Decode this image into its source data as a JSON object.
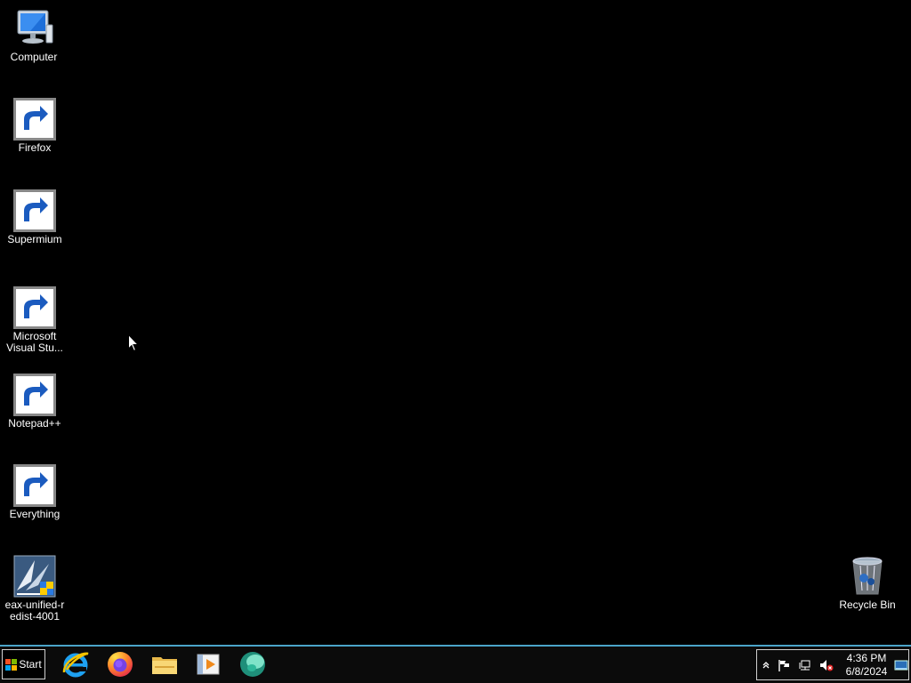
{
  "desktop": {
    "icons": [
      {
        "label": "Computer",
        "icon": "computer-icon",
        "shortcut": false
      },
      {
        "label": "Firefox",
        "icon": "firefox-icon",
        "shortcut": true
      },
      {
        "label": "Supermium",
        "icon": "supermium-icon",
        "shortcut": true
      },
      {
        "label": "Microsoft Visual Stu...",
        "icon": "visual-studio-icon",
        "shortcut": true
      },
      {
        "label": "Notepad++",
        "icon": "notepad-plus-plus-icon",
        "shortcut": true
      },
      {
        "label": "Everything",
        "icon": "everything-search-icon",
        "shortcut": true
      },
      {
        "label": "eax-unified-r edist-4001",
        "icon": "installer-icon",
        "shortcut": false
      },
      {
        "label": "Recycle Bin",
        "icon": "recycle-bin-icon",
        "shortcut": false
      }
    ]
  },
  "taskbar": {
    "start_label": "Start",
    "pinned": [
      {
        "name": "Internet Explorer",
        "icon": "internet-explorer-icon"
      },
      {
        "name": "Firefox",
        "icon": "firefox-icon"
      },
      {
        "name": "File Explorer",
        "icon": "folder-icon"
      },
      {
        "name": "Media Player",
        "icon": "media-player-icon"
      },
      {
        "name": "Supermium",
        "icon": "supermium-icon"
      }
    ],
    "tray": {
      "icons": [
        "show-hidden-icons-icon",
        "action-center-flag-icon",
        "network-icon",
        "volume-muted-icon"
      ],
      "time": "4:36 PM",
      "date": "6/8/2024"
    }
  },
  "colors": {
    "desktop_background": "#000000",
    "taskbar_background": "#0b0b0b",
    "taskbar_border": "#4aa3c8",
    "label_text": "#ffffff"
  }
}
